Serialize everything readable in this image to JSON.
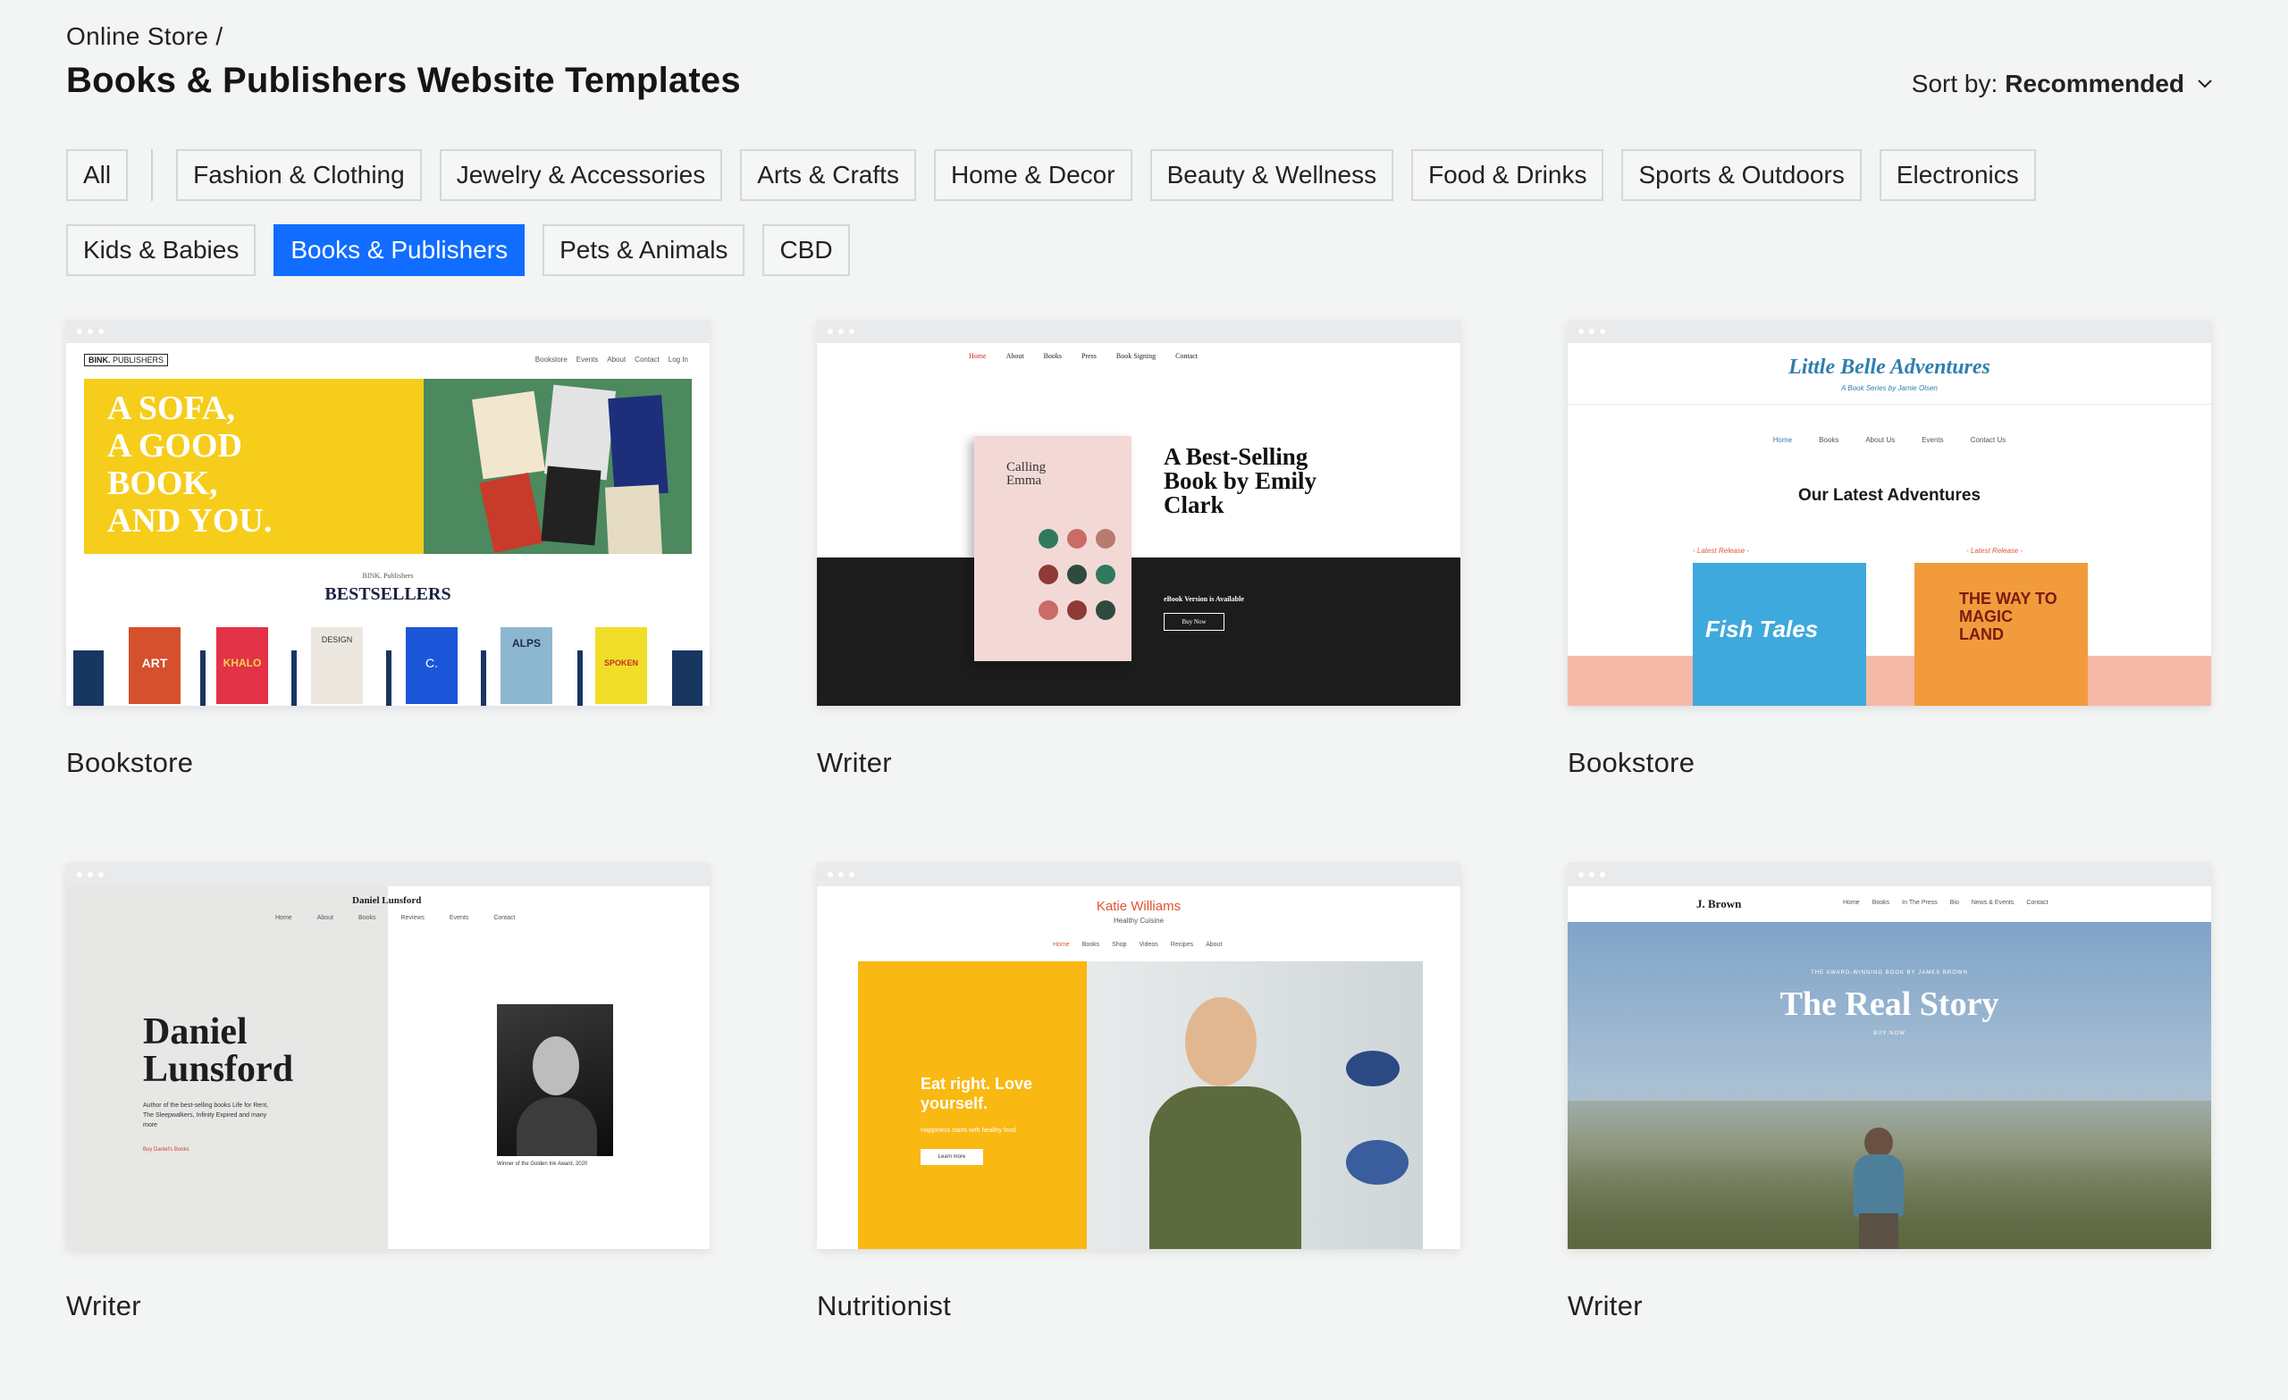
{
  "header": {
    "breadcrumb": "Online Store /",
    "title": "Books & Publishers Website Templates",
    "sort_label": "Sort by:",
    "sort_value": "Recommended"
  },
  "filters": {
    "row1": [
      "All",
      "Fashion & Clothing",
      "Jewelry & Accessories",
      "Arts & Crafts",
      "Home & Decor",
      "Beauty & Wellness",
      "Food & Drinks",
      "Sports & Outdoors",
      "Electronics"
    ],
    "row2": [
      "Kids & Babies",
      "Books & Publishers",
      "Pets & Animals",
      "CBD"
    ],
    "active": "Books & Publishers"
  },
  "templates": [
    {
      "label": "Bookstore",
      "preview": {
        "logo": "BINK.",
        "logo_sub": "PUBLISHERS",
        "nav": [
          "Bookstore",
          "Events",
          "About",
          "Contact",
          "Log In"
        ],
        "hero": [
          "A SOFA,",
          "A GOOD",
          "BOOK,",
          "AND YOU."
        ],
        "publisher": "BINK. Publishers",
        "section": "BESTSELLERS",
        "covers": [
          "ART",
          "KHALO",
          "DESIGN",
          "C.",
          "ALPS",
          "SPOKEN WORD"
        ]
      }
    },
    {
      "label": "Writer",
      "preview": {
        "nav": [
          "Home",
          "About",
          "Books",
          "Press",
          "Book Signing",
          "Contact"
        ],
        "book_title": "Calling Emma",
        "headline": "A Best-Selling Book by Emily Clark",
        "ebook": "eBook Version is Available",
        "cta": "Buy Now"
      }
    },
    {
      "label": "Bookstore",
      "preview": {
        "title": "Little Belle Adventures",
        "subtitle": "A Book Series by Jamie Olsen",
        "nav": [
          "Home",
          "Books",
          "About Us",
          "Events",
          "Contact Us"
        ],
        "section": "Our Latest Adventures",
        "release": "- Latest Release -",
        "books": [
          "Fish Tales",
          "THE WAY TO MAGIC LAND"
        ]
      }
    },
    {
      "label": "Writer",
      "preview": {
        "site": "Daniel Lunsford",
        "nav": [
          "Home",
          "About",
          "Books",
          "Reviews",
          "Events",
          "Contact"
        ],
        "name": "Daniel Lunsford",
        "bio": "Author of the best-selling books Life for Rent, The Sleepwalkers, Infinity Expired and many more",
        "link": "Buy Daniel's Books",
        "caption": "Winner of the Golden Ink Award, 2020"
      }
    },
    {
      "label": "Nutritionist",
      "preview": {
        "name": "Katie Williams",
        "tagline": "Healthy Cuisine",
        "nav": [
          "Home",
          "Books",
          "Shop",
          "Videos",
          "Recipes",
          "About"
        ],
        "headline": "Eat right. Love yourself.",
        "sub": "Happiness starts with healthy food",
        "cta": "Learn more"
      }
    },
    {
      "label": "Writer",
      "preview": {
        "logo": "J. Brown",
        "nav": [
          "Home",
          "Books",
          "In The Press",
          "Bio",
          "News & Events",
          "Contact"
        ],
        "kicker": "THE AWARD-WINNING BOOK BY JAMES BROWN",
        "headline": "The Real Story",
        "cta": "BUY NOW"
      }
    }
  ],
  "colors": {
    "accent": "#116dff",
    "background": "#f3f4f4"
  }
}
